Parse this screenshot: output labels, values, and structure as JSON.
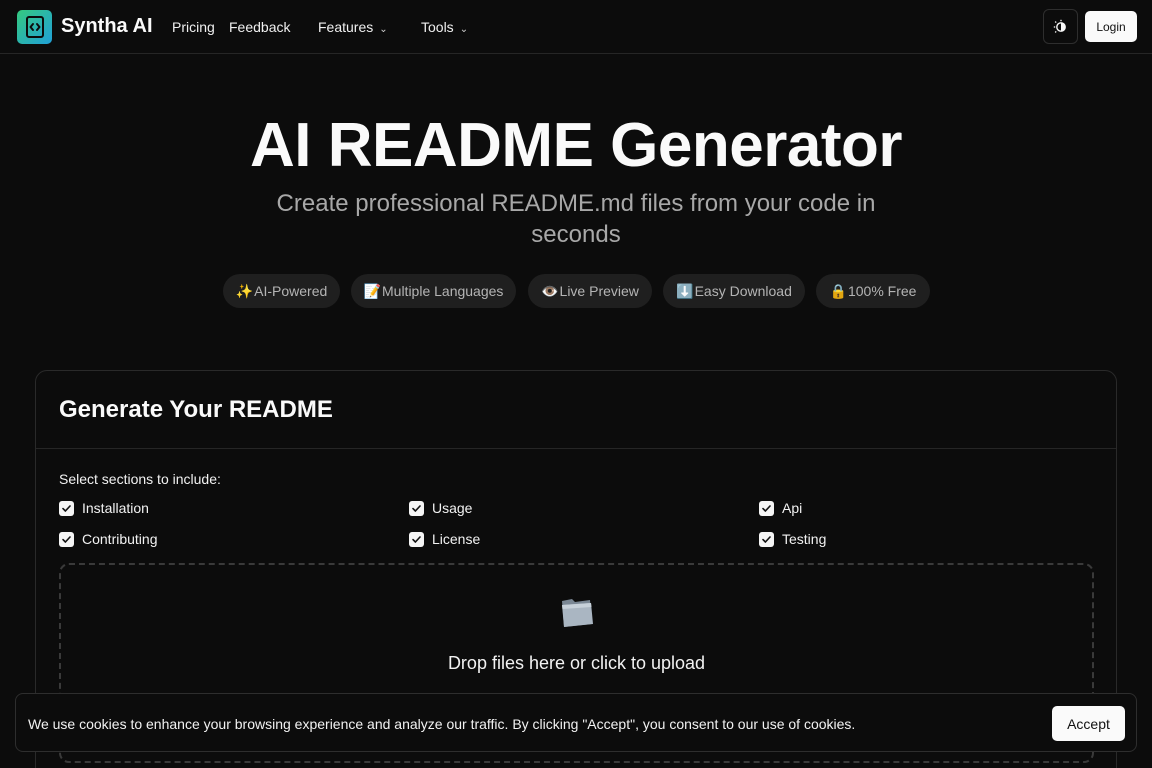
{
  "header": {
    "brand": "Syntha AI",
    "nav": [
      {
        "label": "Pricing"
      },
      {
        "label": "Feedback"
      },
      {
        "label": "Features",
        "chevron": "⌄"
      },
      {
        "label": "Tools",
        "chevron": "⌄"
      }
    ],
    "theme_toggle_icon": "sun-moon-icon",
    "login_label": "Login"
  },
  "hero": {
    "title": "AI README Generator",
    "subtitle": "Create professional README.md files from your code in seconds",
    "features": [
      {
        "emoji": "✨",
        "label": "AI-Powered"
      },
      {
        "emoji": "📝",
        "label": "Multiple Languages"
      },
      {
        "emoji": "👁️",
        "label": "Live Preview"
      },
      {
        "emoji": "⬇️",
        "label": "Easy Download"
      },
      {
        "emoji": "🔒",
        "label": "100% Free"
      }
    ]
  },
  "generator": {
    "title": "Generate Your README",
    "sections_label": "Select sections to include:",
    "sections": [
      {
        "label": "Installation",
        "checked": true
      },
      {
        "label": "Usage",
        "checked": true
      },
      {
        "label": "Api",
        "checked": true
      },
      {
        "label": "Contributing",
        "checked": true
      },
      {
        "label": "License",
        "checked": true
      },
      {
        "label": "Testing",
        "checked": true
      }
    ],
    "dropzone_icon": "folder-icon",
    "dropzone_text": "Drop files here or click to upload"
  },
  "cookie_banner": {
    "text": "We use cookies to enhance your browsing experience and analyze our traffic. By clicking \"Accept\", you consent to our use of cookies.",
    "accept_label": "Accept"
  },
  "colors": {
    "background": "#0c0c0c",
    "logo_gradient_start": "#35c97f",
    "logo_gradient_end": "#20a0d8",
    "pill_background": "#1f1f1f",
    "button_background": "#fafafa"
  }
}
